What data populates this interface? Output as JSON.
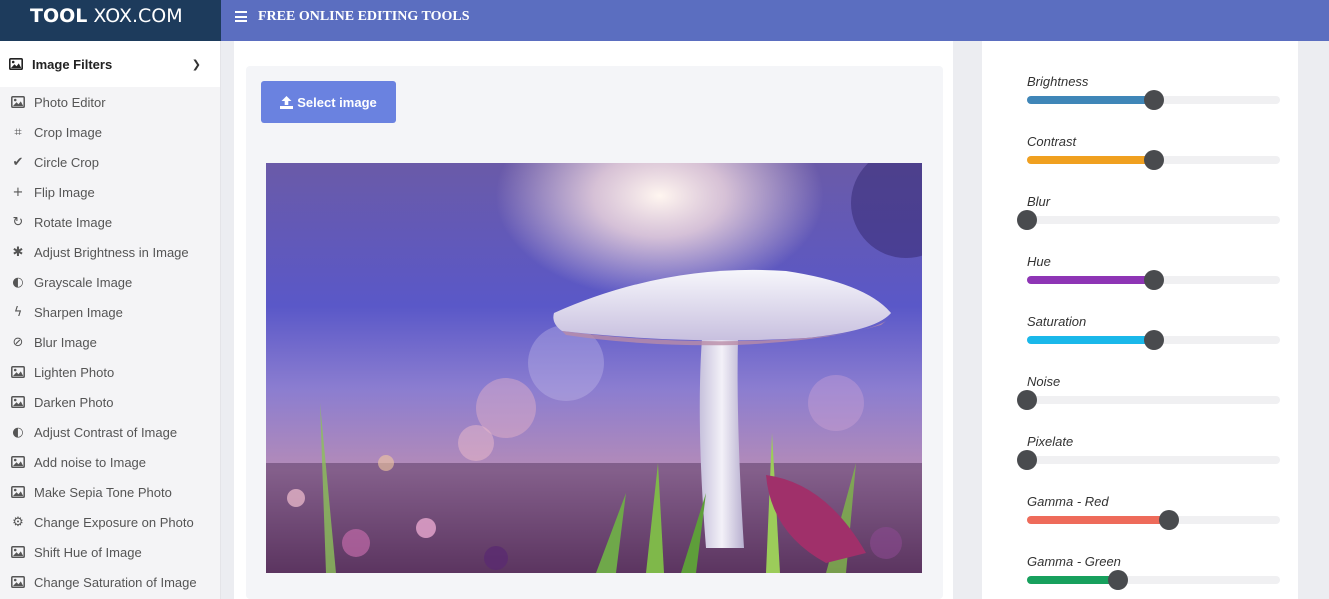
{
  "brand": {
    "bold": "TOOL",
    "rest": " XOX.COM"
  },
  "topbar": {
    "title": "FREE ONLINE EDITING TOOLS",
    "menu_icon": "hamburger-icon"
  },
  "sidebar": {
    "header": {
      "label": "Image Filters",
      "icon": "image-icon",
      "chevron": "chevron-down-icon"
    },
    "items": [
      {
        "label": "Photo Editor",
        "icon": "image-icon"
      },
      {
        "label": "Crop Image",
        "icon": "crop-icon"
      },
      {
        "label": "Circle Crop",
        "icon": "check-circle-icon"
      },
      {
        "label": "Flip Image",
        "icon": "plus-icon"
      },
      {
        "label": "Rotate Image",
        "icon": "rotate-icon"
      },
      {
        "label": "Adjust Brightness in Image",
        "icon": "asterisk-icon"
      },
      {
        "label": "Grayscale Image",
        "icon": "half-circle-icon"
      },
      {
        "label": "Sharpen Image",
        "icon": "bolt-icon"
      },
      {
        "label": "Blur Image",
        "icon": "eye-slash-icon"
      },
      {
        "label": "Lighten Photo",
        "icon": "image-icon"
      },
      {
        "label": "Darken Photo",
        "icon": "image-icon"
      },
      {
        "label": "Adjust Contrast of Image",
        "icon": "half-circle-icon"
      },
      {
        "label": "Add noise to Image",
        "icon": "image-icon"
      },
      {
        "label": "Make Sepia Tone Photo",
        "icon": "image-icon"
      },
      {
        "label": "Change Exposure on Photo",
        "icon": "gear-icon"
      },
      {
        "label": "Shift Hue of Image",
        "icon": "image-icon"
      },
      {
        "label": "Change Saturation of Image",
        "icon": "image-icon"
      }
    ]
  },
  "editor": {
    "select_label": "Select image",
    "select_icon": "upload-icon"
  },
  "sliders": [
    {
      "label": "Brightness",
      "value": 0.5,
      "color": "#3f86b8"
    },
    {
      "label": "Contrast",
      "value": 0.5,
      "color": "#f0a020"
    },
    {
      "label": "Blur",
      "value": 0.0,
      "color": "#999999"
    },
    {
      "label": "Hue",
      "value": 0.5,
      "color": "#8e35b5"
    },
    {
      "label": "Saturation",
      "value": 0.5,
      "color": "#1ab8ea"
    },
    {
      "label": "Noise",
      "value": 0.0,
      "color": "#999999"
    },
    {
      "label": "Pixelate",
      "value": 0.0,
      "color": "#999999"
    },
    {
      "label": "Gamma - Red",
      "value": 0.56,
      "color": "#ee6b5a"
    },
    {
      "label": "Gamma - Green",
      "value": 0.36,
      "color": "#17a05d"
    }
  ]
}
